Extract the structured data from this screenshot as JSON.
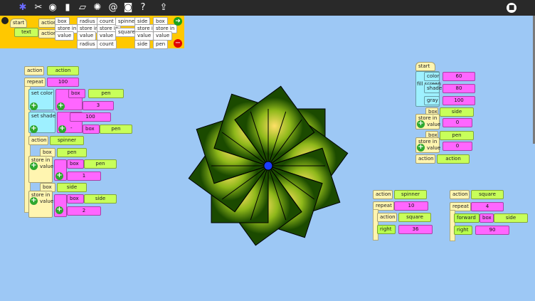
{
  "toolbar": {
    "icons": [
      "turtle-icon",
      "scissors-icon",
      "eye-icon",
      "book-icon",
      "eraser-icon",
      "turtle-fast-icon",
      "spiral-icon",
      "camera-icon",
      "help-icon",
      "export-icon",
      "stop-icon"
    ]
  },
  "palette": {
    "start": "start",
    "text": "text",
    "action1": "action",
    "action2": "action",
    "box": "box",
    "store_in": "store in",
    "value": "value",
    "radius": "radius",
    "count": "count",
    "spinner": "spinner",
    "square": "square",
    "side": "side",
    "pen": "pen"
  },
  "stack_action": {
    "action": "action",
    "action_name": "action",
    "repeat": "repeat",
    "repeat_n": "100",
    "set_color": "set color",
    "box": "box",
    "pen": "pen",
    "div": "/",
    "div_n": "3",
    "set_shade": "set shade",
    "shade_n": "100",
    "minus": "-",
    "box2": "box",
    "pen2": "pen",
    "action2": "action",
    "spinner": "spinner",
    "box3": "box",
    "pen3": "pen",
    "store_in": "store in",
    "value": "value",
    "box4": "box",
    "pen4": "pen",
    "add_n": "1",
    "box5": "box",
    "side": "side",
    "store_in2": "store in",
    "value2": "value",
    "box6": "box",
    "side2": "side",
    "add_n2": "2"
  },
  "stack_start": {
    "start": "start",
    "fill_screen": "fill screen",
    "color": "color",
    "color_n": "60",
    "shade": "shade",
    "shade_n": "80",
    "gray": "gray",
    "gray_n": "100",
    "box": "box",
    "side": "side",
    "store_in": "store in",
    "value": "value",
    "value_n": "0",
    "box2": "box",
    "pen": "pen",
    "store_in2": "store in",
    "value2": "value",
    "value_n2": "0",
    "action": "action",
    "action_name": "action"
  },
  "stack_spinner": {
    "action": "action",
    "name": "spinner",
    "repeat": "repeat",
    "repeat_n": "10",
    "action2": "action",
    "call": "square",
    "right": "right",
    "right_n": "36"
  },
  "stack_square": {
    "action": "action",
    "name": "square",
    "repeat": "repeat",
    "repeat_n": "4",
    "forward": "forward",
    "box": "box",
    "side": "side",
    "right": "right",
    "right_n": "90"
  }
}
